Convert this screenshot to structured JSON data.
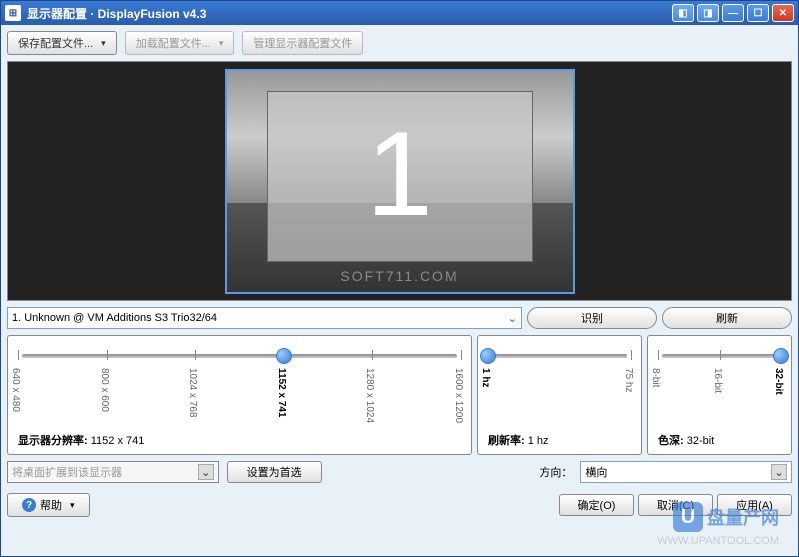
{
  "title": "显示器配置 · DisplayFusion v4.3",
  "toolbar": {
    "save_profile": "保存配置文件...",
    "load_profile": "加载配置文件...",
    "manage_profile": "管理显示器配置文件"
  },
  "monitor": {
    "number": "1",
    "selected": "1. Unknown @ VM Additions S3 Trio32/64",
    "identify_btn": "识别",
    "refresh_btn": "刷新",
    "preview_watermark": "SOFT711.COM"
  },
  "resolution": {
    "label_prefix": "显示器分辨率:",
    "value": "1152 x 741",
    "ticks": [
      "640 x 480",
      "800 x 600",
      "1024 x 768",
      "1152 x 741",
      "1280 x 1024",
      "1600 x 1200"
    ],
    "selected_index": 3
  },
  "refresh_rate": {
    "label_prefix": "刷新率:",
    "value": "1 hz",
    "ticks": [
      "1 hz",
      "75 hz"
    ],
    "selected_index": 0
  },
  "color_depth": {
    "label_prefix": "色深:",
    "value": "32-bit",
    "ticks": [
      "8-bit",
      "16-bit",
      "32-bit"
    ],
    "selected_index": 2
  },
  "extend": {
    "dropdown_placeholder": "将桌面扩展到该显示器",
    "set_primary_btn": "设置为首选"
  },
  "orientation": {
    "label": "方向：",
    "value": "横向"
  },
  "actions": {
    "help": "帮助",
    "ok": "确定(O)",
    "cancel": "取消(C)",
    "apply": "应用(A)"
  },
  "site_watermark": {
    "text": "盘量产网",
    "url": "WWW.UPANTOOL.COM"
  }
}
